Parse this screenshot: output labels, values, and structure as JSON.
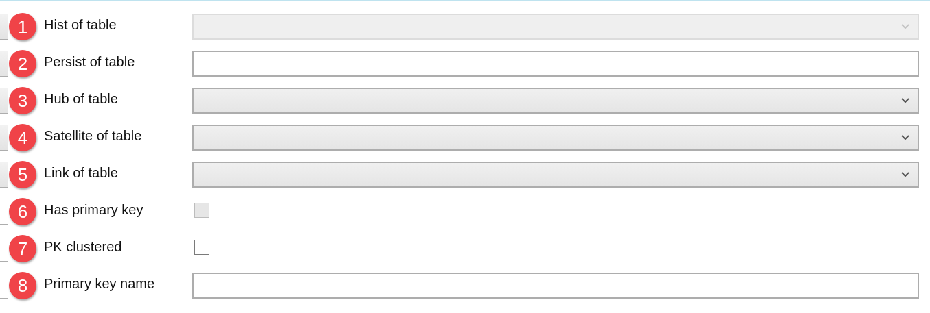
{
  "fields": [
    {
      "number": "1",
      "label": "Hist of table",
      "kind": "combo",
      "disabled": true
    },
    {
      "number": "2",
      "label": "Persist of table",
      "kind": "text",
      "disabled": false
    },
    {
      "number": "3",
      "label": "Hub of table",
      "kind": "combo",
      "disabled": false
    },
    {
      "number": "4",
      "label": "Satellite of table",
      "kind": "combo",
      "disabled": false
    },
    {
      "number": "5",
      "label": "Link of table",
      "kind": "combo",
      "disabled": false
    },
    {
      "number": "6",
      "label": "Has primary key",
      "kind": "checkbox",
      "disabled": true,
      "checked": false
    },
    {
      "number": "7",
      "label": "PK clustered",
      "kind": "checkbox",
      "disabled": false,
      "checked": false
    },
    {
      "number": "8",
      "label": "Primary key name",
      "kind": "text",
      "disabled": false
    }
  ]
}
